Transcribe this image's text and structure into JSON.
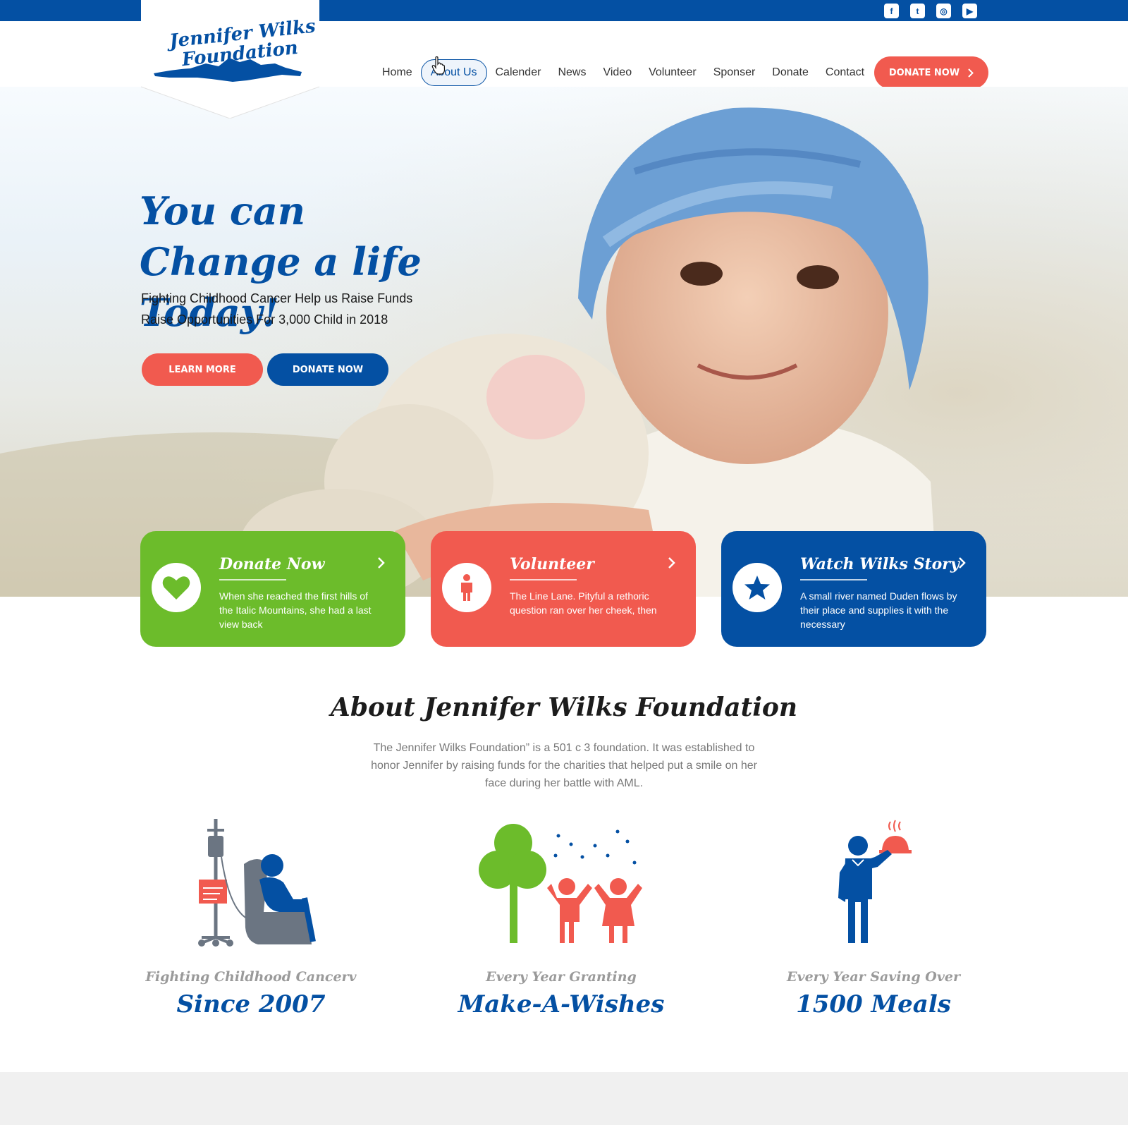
{
  "brand": {
    "name_line1": "Jennifer Wilks",
    "name_line2": "Foundation"
  },
  "social": [
    {
      "icon": "facebook-icon",
      "glyph": "f"
    },
    {
      "icon": "twitter-icon",
      "glyph": "t"
    },
    {
      "icon": "instagram-icon",
      "glyph": "◎"
    },
    {
      "icon": "youtube-icon",
      "glyph": "▶"
    }
  ],
  "nav": {
    "items": [
      "Home",
      "About Us",
      "Calender",
      "News",
      "Video",
      "Volunteer",
      "Sponser",
      "Donate",
      "Contact"
    ],
    "active": "About Us",
    "cta": "DONATE NOW"
  },
  "hero": {
    "title": "You can Change a life Today!",
    "subtitle": "Fighting Childhood Cancer Help us Raise Funds Raise Opportunities For 3,000 Child in 2018",
    "learn_more": "LEARN MORE",
    "donate_now": "DONATE NOW"
  },
  "cards": [
    {
      "title": "Donate Now",
      "text": "When she reached the first hills of the Italic Mountains, she had a last view back",
      "icon": "heart-icon",
      "color": "#6cbc2b"
    },
    {
      "title": "Volunteer",
      "text": "The Line Lane. Pityful a rethoric question ran over her cheek, then",
      "icon": "person-icon",
      "color": "#f15a4f"
    },
    {
      "title": "Watch Wilks Story",
      "text": "A small river named Duden flows by their place and supplies it with the necessary",
      "icon": "star-icon",
      "color": "#0450a3"
    }
  ],
  "about": {
    "title": "About  Jennifer Wilks Foundation",
    "text": "The Jennifer Wilks Foundation” is a 501 c 3 foundation. It was established to honor Jennifer by raising funds for the charities that helped put a smile on her face during her battle with AML."
  },
  "stats": [
    {
      "small": "Fighting Childhood Cancerv",
      "big": "Since 2007",
      "icon": "chemo-chair-icon"
    },
    {
      "small": "Every Year Granting",
      "big": "Make-A-Wishes",
      "icon": "children-tree-icon"
    },
    {
      "small": "Every Year Saving Over",
      "big": "1500 Meals",
      "icon": "waiter-icon"
    }
  ],
  "colors": {
    "brand_blue": "#0450a3",
    "accent_red": "#f15a4f",
    "accent_green": "#6cbc2b"
  }
}
